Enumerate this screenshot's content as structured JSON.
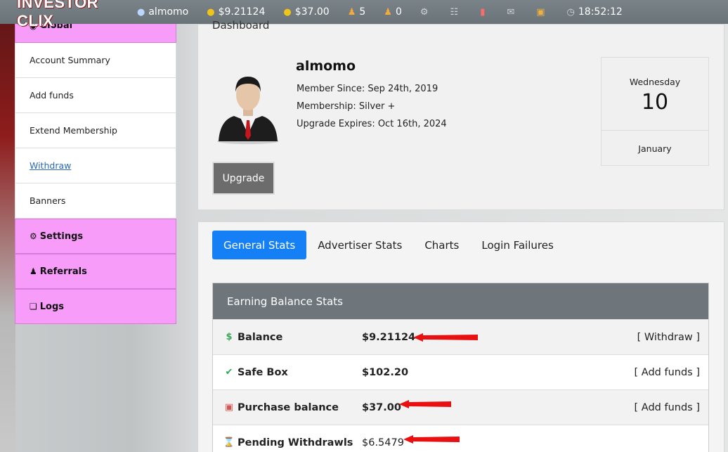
{
  "topbar": {
    "logo": "INVESTOR CLIX",
    "username": "almomo",
    "balance": "$9.21124",
    "purchase": "$37.00",
    "referrals": "5",
    "rented": "0",
    "time": "18:52:12",
    "icons": [
      "user-icon",
      "coins-icon",
      "coins-icon",
      "referrals-icon",
      "rented-referrals-icon",
      "gear-icon",
      "cart-icon",
      "bar-chart-icon",
      "mail-icon",
      "lock-icon",
      "alarm-clock-icon"
    ]
  },
  "sidebar": {
    "global": "Global",
    "items": [
      "Account Summary",
      "Add funds",
      "Extend Membership",
      "Withdraw",
      "Banners"
    ],
    "settings": "Settings",
    "referrals": "Referrals",
    "logs": "Logs"
  },
  "dashboard": {
    "title": "Dashboard",
    "username": "almomo",
    "member_since": "Member Since: Sep 24th, 2019",
    "membership": "Membership: Silver +",
    "upgrade_expires": "Upgrade Expires: Oct 16th, 2024",
    "upgrade_button": "Upgrade"
  },
  "calendar": {
    "weekday": "Wednesday",
    "day": "10",
    "month": "January"
  },
  "tabs": [
    "General Stats",
    "Advertiser Stats",
    "Charts",
    "Login Failures"
  ],
  "stats": {
    "header": "Earning Balance Stats",
    "rows": [
      {
        "label": "Balance",
        "value": "$9.21124",
        "action": "[ Withdraw ]",
        "icon": "dollar-icon"
      },
      {
        "label": "Safe Box",
        "value": "$102.20",
        "action": "[ Add funds ]",
        "icon": "check-circle-icon"
      },
      {
        "label": "Purchase balance",
        "value": "$37.00",
        "action": "[ Add funds ]",
        "icon": "purchase-icon"
      },
      {
        "label": "Pending Withdrawls",
        "value": "$6.5479",
        "action": "",
        "icon": "hourglass-icon"
      }
    ]
  },
  "colors": {
    "topbar": "#6a7378",
    "sidebar_pink": "#f79cf9",
    "tab_active": "#1580f5",
    "stats_header": "#6e767c",
    "arrow": "#e81010"
  }
}
